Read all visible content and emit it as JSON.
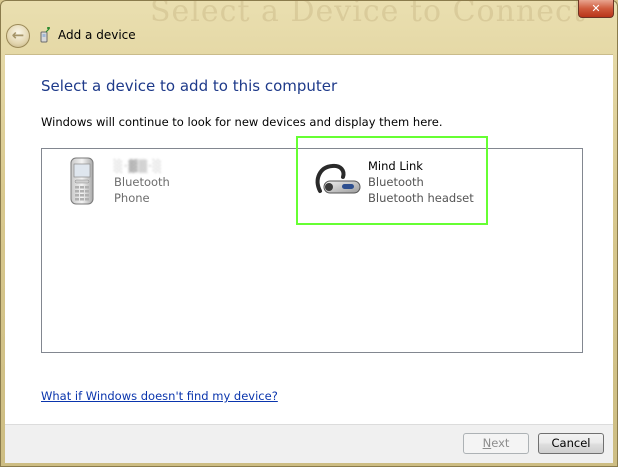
{
  "window": {
    "title_bg_text": "Select a Device to Connect",
    "close_label": "✕"
  },
  "wizard": {
    "title": "Add a device",
    "heading": "Select a device to add to this computer",
    "subtext": "Windows will continue to look for new devices and display them here."
  },
  "devices": [
    {
      "name": "░·▓▒·░",
      "type": "Bluetooth",
      "category": "Phone",
      "icon": "mobile-phone-icon"
    },
    {
      "name": "Mind Link",
      "type": "Bluetooth",
      "category": "Bluetooth headset",
      "icon": "bluetooth-headset-icon"
    }
  ],
  "help_link": "What if Windows doesn't find my device?",
  "buttons": {
    "next_label_access": "N",
    "next_label_rest": "ext",
    "cancel_label": "Cancel"
  },
  "colors": {
    "heading": "#1e3a8a",
    "link": "#0a35ad",
    "highlight": "#66ff33"
  }
}
